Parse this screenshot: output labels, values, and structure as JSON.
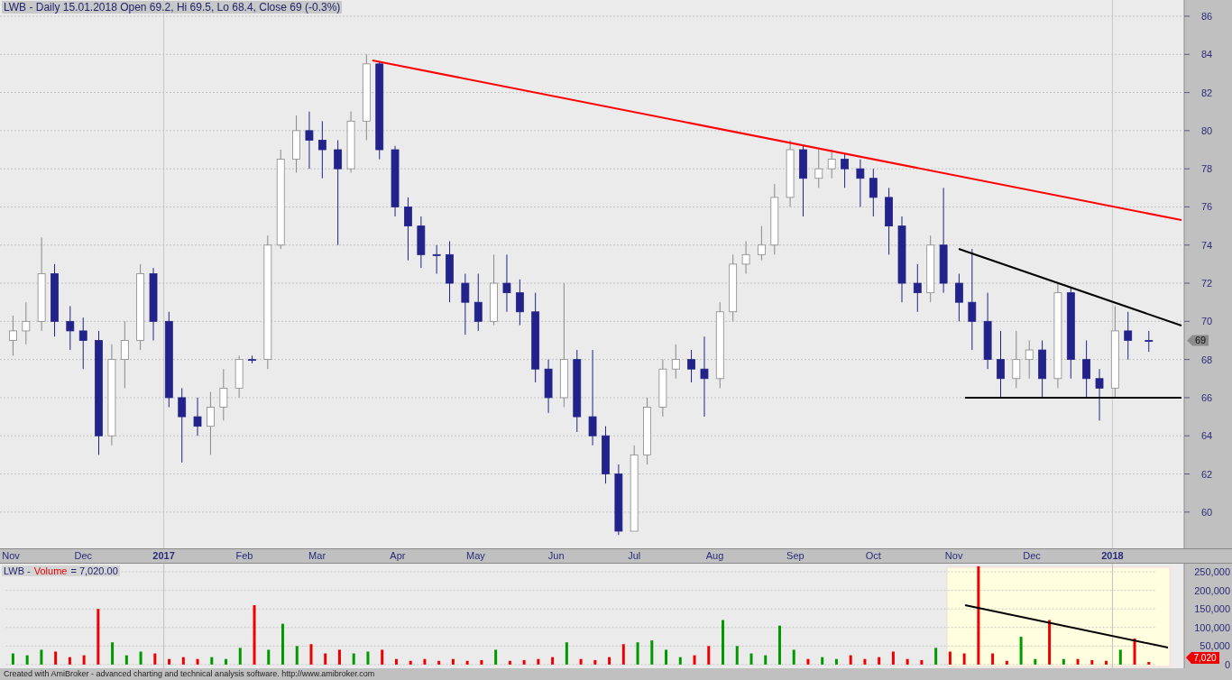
{
  "price_chart": {
    "title": "LWB - Daily 15.01.2018 Open 69.2, Hi 69.5, Lo 68.4, Close 69 (-0.3%)",
    "last_value_label": "69",
    "chart_data": {
      "type": "candlestick",
      "grid": true,
      "xlim": [
        "2016-10-30",
        "2018-02-16"
      ],
      "ylim": [
        58.1,
        86.85
      ],
      "yticks": [
        {
          "value": 60,
          "label": "60"
        },
        {
          "value": 62,
          "label": "62"
        },
        {
          "value": 64,
          "label": "64"
        },
        {
          "value": 66,
          "label": "66"
        },
        {
          "value": 68,
          "label": "68"
        },
        {
          "value": 70,
          "label": "70"
        },
        {
          "value": 72,
          "label": "72"
        },
        {
          "value": 74,
          "label": "74"
        },
        {
          "value": 76,
          "label": "76"
        },
        {
          "value": 78,
          "label": "78"
        },
        {
          "value": 80,
          "label": "80"
        },
        {
          "value": 82,
          "label": "82"
        },
        {
          "value": 84,
          "label": "84"
        },
        {
          "value": 86,
          "label": "86"
        }
      ],
      "xticks": [
        {
          "value": "2016-11-01",
          "label": "Nov"
        },
        {
          "value": "2016-12-01",
          "label": "Dec"
        },
        {
          "value": "2017-01-01",
          "label": "2017"
        },
        {
          "value": "2017-02-01",
          "label": "Feb"
        },
        {
          "value": "2017-03-01",
          "label": "Mar"
        },
        {
          "value": "2017-04-01",
          "label": "Apr"
        },
        {
          "value": "2017-05-01",
          "label": "May"
        },
        {
          "value": "2017-06-01",
          "label": "Jun"
        },
        {
          "value": "2017-07-01",
          "label": "Jul"
        },
        {
          "value": "2017-08-01",
          "label": "Aug"
        },
        {
          "value": "2017-09-01",
          "label": "Sep"
        },
        {
          "value": "2017-10-01",
          "label": "Oct"
        },
        {
          "value": "2017-11-01",
          "label": "Nov"
        },
        {
          "value": "2017-12-01",
          "label": "Dec"
        },
        {
          "value": "2018-01-01",
          "label": "2018"
        }
      ],
      "x": [
        "2016-11-04",
        "2016-11-09",
        "2016-11-15",
        "2016-11-20",
        "2016-11-26",
        "2016-12-01",
        "2016-12-07",
        "2016-12-12",
        "2016-12-17",
        "2016-12-23",
        "2016-12-28",
        "2017-01-03",
        "2017-01-08",
        "2017-01-14",
        "2017-01-19",
        "2017-01-24",
        "2017-01-30",
        "2017-02-04",
        "2017-02-10",
        "2017-02-15",
        "2017-02-21",
        "2017-02-26",
        "2017-03-03",
        "2017-03-09",
        "2017-03-14",
        "2017-03-20",
        "2017-03-25",
        "2017-03-31",
        "2017-04-05",
        "2017-04-10",
        "2017-04-16",
        "2017-04-21",
        "2017-04-27",
        "2017-05-02",
        "2017-05-08",
        "2017-05-13",
        "2017-05-18",
        "2017-05-24",
        "2017-05-29",
        "2017-06-04",
        "2017-06-09",
        "2017-06-15",
        "2017-06-20",
        "2017-06-25",
        "2017-07-01",
        "2017-07-06",
        "2017-07-12",
        "2017-07-17",
        "2017-07-23",
        "2017-07-28",
        "2017-08-03",
        "2017-08-08",
        "2017-08-13",
        "2017-08-19",
        "2017-08-24",
        "2017-08-30",
        "2017-09-04",
        "2017-09-10",
        "2017-09-15",
        "2017-09-20",
        "2017-09-26",
        "2017-10-01",
        "2017-10-07",
        "2017-10-12",
        "2017-10-18",
        "2017-10-23",
        "2017-10-28",
        "2017-11-03",
        "2017-11-08",
        "2017-11-14",
        "2017-11-19",
        "2017-11-25",
        "2017-11-30",
        "2017-12-05",
        "2017-12-11",
        "2017-12-16",
        "2017-12-22",
        "2017-12-27",
        "2018-01-02",
        "2018-01-07",
        "2018-01-15"
      ],
      "ohlc": [
        [
          69,
          70.3,
          68.2,
          69.5
        ],
        [
          69.5,
          71,
          68.8,
          70
        ],
        [
          70,
          74.4,
          69.5,
          72.5
        ],
        [
          72.5,
          73,
          69.2,
          70
        ],
        [
          70,
          70.8,
          68.5,
          69.5
        ],
        [
          69.5,
          70.2,
          67.5,
          69
        ],
        [
          69,
          69.5,
          63,
          64
        ],
        [
          64,
          68.8,
          63.5,
          68
        ],
        [
          68,
          70,
          66.5,
          69
        ],
        [
          69,
          73,
          68.5,
          72.5
        ],
        [
          72.5,
          72.8,
          69,
          70
        ],
        [
          70,
          70.5,
          65.5,
          66
        ],
        [
          66,
          66.5,
          62.6,
          65
        ],
        [
          65,
          66,
          64,
          64.5
        ],
        [
          64.5,
          66.3,
          63,
          65.5
        ],
        [
          65.5,
          67.5,
          64.8,
          66.5
        ],
        [
          66.5,
          68.2,
          66,
          68
        ],
        [
          68,
          68.2,
          67.8,
          68
        ],
        [
          68,
          74.5,
          67.5,
          74
        ],
        [
          74,
          79,
          73.8,
          78.5
        ],
        [
          78.5,
          80.8,
          77.8,
          80
        ],
        [
          80,
          81,
          78,
          79.5
        ],
        [
          79.5,
          80.5,
          77.5,
          79
        ],
        [
          79,
          79.5,
          74,
          78
        ],
        [
          78,
          81,
          77.8,
          80.5
        ],
        [
          80.5,
          84,
          79.5,
          83.5
        ],
        [
          83.5,
          83.6,
          78.5,
          79
        ],
        [
          79,
          79.2,
          75.5,
          76
        ],
        [
          76,
          76.5,
          73.2,
          75
        ],
        [
          75,
          75.5,
          72.8,
          73.5
        ],
        [
          73.5,
          74,
          72.5,
          73.5
        ],
        [
          73.5,
          74.2,
          71,
          72
        ],
        [
          72,
          72.5,
          69.3,
          71
        ],
        [
          71,
          72.5,
          69.5,
          70
        ],
        [
          70,
          73.5,
          69.8,
          72
        ],
        [
          72,
          73.5,
          70.5,
          71.5
        ],
        [
          71.5,
          72.2,
          69.8,
          70.5
        ],
        [
          70.5,
          71.5,
          66.8,
          67.5
        ],
        [
          67.5,
          68,
          65.2,
          66
        ],
        [
          66,
          72,
          65.5,
          68
        ],
        [
          68,
          68.5,
          64.2,
          65
        ],
        [
          65,
          68.5,
          63.5,
          64
        ],
        [
          64,
          64.5,
          61.5,
          62
        ],
        [
          62,
          62.5,
          58.8,
          59
        ],
        [
          59,
          63.5,
          59,
          63
        ],
        [
          63,
          66,
          62.5,
          65.5
        ],
        [
          65.5,
          68,
          65,
          67.5
        ],
        [
          67.5,
          68.8,
          67,
          68
        ],
        [
          68,
          68.5,
          66.8,
          67.5
        ],
        [
          67.5,
          69.2,
          65,
          67
        ],
        [
          67,
          71,
          66.5,
          70.5
        ],
        [
          70.5,
          73.5,
          70,
          73
        ],
        [
          73,
          74.2,
          72.5,
          73.5
        ],
        [
          73.5,
          75,
          73.2,
          74
        ],
        [
          74,
          77.2,
          73.5,
          76.5
        ],
        [
          76.5,
          79.5,
          76,
          79
        ],
        [
          79,
          79.2,
          75.5,
          77.5
        ],
        [
          77.5,
          79,
          77,
          78
        ],
        [
          78,
          79,
          77.5,
          78.5
        ],
        [
          78.5,
          78.8,
          77,
          78
        ],
        [
          78,
          78.5,
          76,
          77.5
        ],
        [
          77.5,
          78,
          75.5,
          76.5
        ],
        [
          76.5,
          77,
          73.5,
          75
        ],
        [
          75,
          75.5,
          71,
          72
        ],
        [
          72,
          73,
          70.5,
          71.5
        ],
        [
          71.5,
          74.5,
          71,
          74
        ],
        [
          74,
          77,
          71.5,
          72
        ],
        [
          72,
          72.5,
          70,
          71
        ],
        [
          71,
          73.8,
          68.5,
          70
        ],
        [
          70,
          71.5,
          67.5,
          68
        ],
        [
          68,
          69.5,
          66,
          67
        ],
        [
          67,
          69.5,
          66.5,
          68
        ],
        [
          68,
          69,
          67,
          68.5
        ],
        [
          68.5,
          69,
          66,
          67
        ],
        [
          67,
          72,
          66.5,
          71.5
        ],
        [
          71.5,
          71.8,
          67,
          68
        ],
        [
          68,
          69,
          66,
          67
        ],
        [
          67,
          67.5,
          64.8,
          66.5
        ],
        [
          66.5,
          70.8,
          66,
          69.5
        ],
        [
          69.5,
          70.5,
          68,
          69
        ],
        [
          69,
          69.5,
          68.4,
          69
        ]
      ]
    }
  },
  "volume_chart": {
    "prefix": "LWB -",
    "value": "= 7,020.00",
    "last_value_label": "7,020",
    "chart_data": {
      "type": "bar",
      "grid": true,
      "ylim": [
        -10000,
        272000
      ],
      "yticks": [
        {
          "value": 0,
          "label": "0"
        },
        {
          "value": 50000,
          "label": "50,000"
        },
        {
          "value": 100000,
          "label": "100,000"
        },
        {
          "value": 150000,
          "label": "150,000"
        },
        {
          "value": 200000,
          "label": "200,000"
        },
        {
          "value": 250000,
          "label": "250,000"
        }
      ],
      "series": [
        {
          "name": "Volume",
          "values": [
            30000,
            25000,
            40000,
            35000,
            20000,
            25000,
            150000,
            60000,
            25000,
            35000,
            30000,
            15000,
            20000,
            15000,
            20000,
            15000,
            45000,
            160000,
            40000,
            110000,
            50000,
            55000,
            30000,
            40000,
            30000,
            35000,
            40000,
            15000,
            10000,
            15000,
            10000,
            15000,
            10000,
            12000,
            40000,
            10000,
            12000,
            15000,
            20000,
            60000,
            15000,
            12000,
            20000,
            55000,
            60000,
            65000,
            40000,
            20000,
            25000,
            50000,
            120000,
            50000,
            30000,
            25000,
            105000,
            40000,
            15000,
            20000,
            15000,
            25000,
            15000,
            20000,
            35000,
            15000,
            12000,
            45000,
            35000,
            30000,
            265000,
            30000,
            10000,
            75000,
            15000,
            120000,
            15000,
            15000,
            12000,
            10000,
            40000,
            70000,
            7020
          ]
        }
      ]
    }
  },
  "footer": "Created with AmiBroker - advanced charting and technical analysis software. http://www.amibroker.com"
}
